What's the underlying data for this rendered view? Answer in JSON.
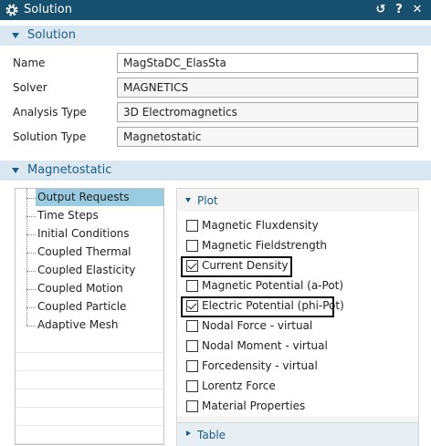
{
  "titlebar": {
    "title": "Solution",
    "icons": [
      "gear-icon",
      "reset-icon",
      "help-icon",
      "close-icon"
    ],
    "reset_glyph": "↺",
    "help_glyph": "?",
    "close_glyph": "✕"
  },
  "solution_section": {
    "header": "Solution",
    "fields": [
      {
        "label": "Name",
        "value": "MagStaDC_ElasSta"
      },
      {
        "label": "Solver",
        "value": "MAGNETICS"
      },
      {
        "label": "Analysis Type",
        "value": "3D Electromagnetics"
      },
      {
        "label": "Solution Type",
        "value": "Magnetostatic"
      }
    ]
  },
  "magnetostatic_section": {
    "header": "Magnetostatic",
    "tree_items": [
      "Output Requests",
      "Time Steps",
      "Initial Conditions",
      "Coupled Thermal",
      "Coupled Elasticity",
      "Coupled Motion",
      "Coupled Particle",
      "Adaptive Mesh"
    ],
    "selected_tree_item": "Output Requests"
  },
  "plot_group": {
    "header": "Plot",
    "options": [
      {
        "label": "Magnetic Fluxdensity",
        "checked": false
      },
      {
        "label": "Magnetic Fieldstrength",
        "checked": false
      },
      {
        "label": "Current Density",
        "checked": true
      },
      {
        "label": "Magnetic Potential (a-Pot)",
        "checked": false
      },
      {
        "label": "Electric Potential (phi-Pot)",
        "checked": true
      },
      {
        "label": "Nodal Force - virtual",
        "checked": false
      },
      {
        "label": "Nodal Moment - virtual",
        "checked": false
      },
      {
        "label": "Forcedensity - virtual",
        "checked": false
      },
      {
        "label": "Lorentz Force",
        "checked": false
      },
      {
        "label": "Material Properties",
        "checked": false
      }
    ]
  },
  "table_group": {
    "header": "Table"
  },
  "colors": {
    "titlebar": "#17506f",
    "section_header_bg": "#dbe8f1",
    "accent_text": "#1a5d85",
    "selection": "#99cce0"
  }
}
